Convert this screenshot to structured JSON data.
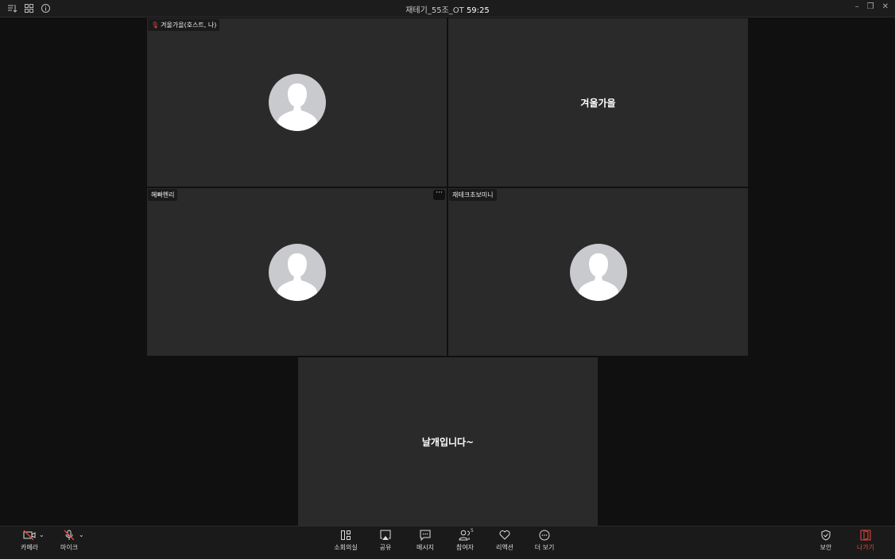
{
  "window": {
    "title": "재테기_55조_OT",
    "timer": "59:25"
  },
  "tiles": [
    {
      "name": "겨울가을(호스트, 나)",
      "muted": true,
      "type": "avatar"
    },
    {
      "name": "겨울가을",
      "type": "name"
    },
    {
      "name": "혜빠헨리",
      "type": "avatar"
    },
    {
      "name": "재테크초보미니",
      "type": "avatar"
    },
    {
      "name": "날개입니다~",
      "type": "name"
    }
  ],
  "more_label": "···",
  "toolbar": {
    "camera": "카메라",
    "mic": "마이크",
    "breakout": "소회의실",
    "share": "공유",
    "chat": "메시지",
    "participants": "참여자",
    "participants_count": "5",
    "reactions": "리액션",
    "more": "더 보기",
    "security": "보안",
    "leave": "나가기"
  },
  "colors": {
    "leave": "#e8453c"
  }
}
